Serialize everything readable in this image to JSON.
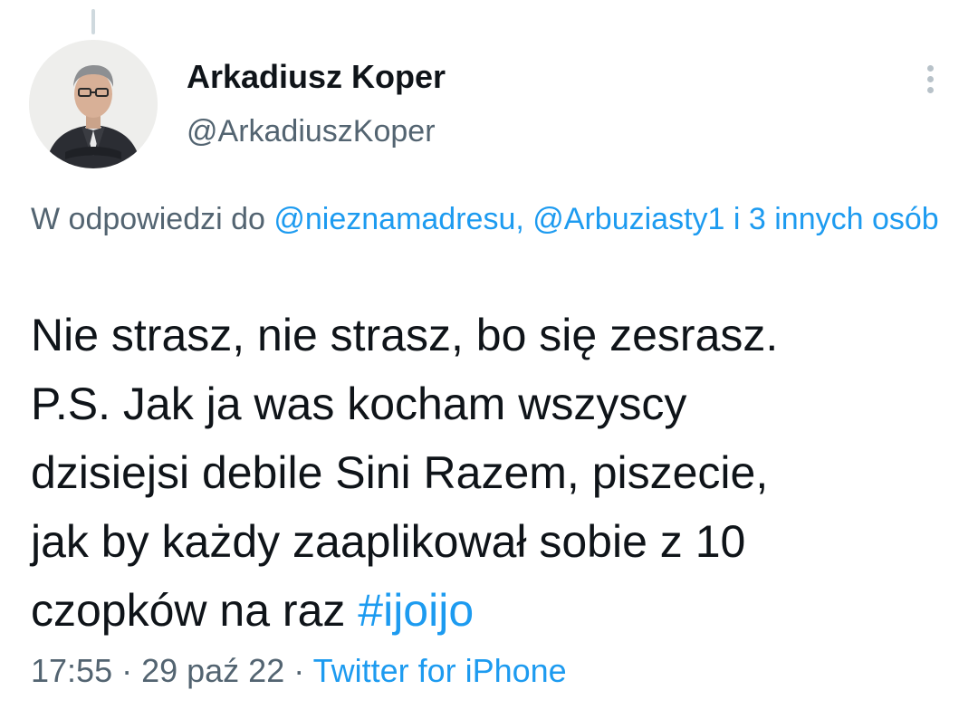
{
  "author": {
    "name": "Arkadiusz Koper",
    "handle": "@ArkadiuszKoper"
  },
  "reply_context": {
    "prefix": "W odpowiedzi do ",
    "mention_1": "@nieznamadresu",
    "separator": ", ",
    "mention_2": "@Arbuziasty1",
    "others": " i 3 innych osób"
  },
  "tweet": {
    "lines": [
      "Nie strasz, nie strasz, bo się zesrasz.",
      "P.S. Jak ja was kocham wszyscy",
      "dzisiejsi debile Sini Razem, piszecie,",
      "jak by każdy zaaplikował sobie z 10"
    ],
    "last_line_text": "czopków na raz ",
    "hashtag": "#ijoijo"
  },
  "meta": {
    "time": "17:55",
    "sep1": " · ",
    "date": "29 paź 22",
    "sep2": " · ",
    "source": "Twitter for iPhone"
  },
  "colors": {
    "link": "#1d9bf0",
    "secondary_text": "#536471",
    "primary_text": "#0f1419"
  },
  "icons": {
    "more": "vertical-ellipsis-icon"
  }
}
